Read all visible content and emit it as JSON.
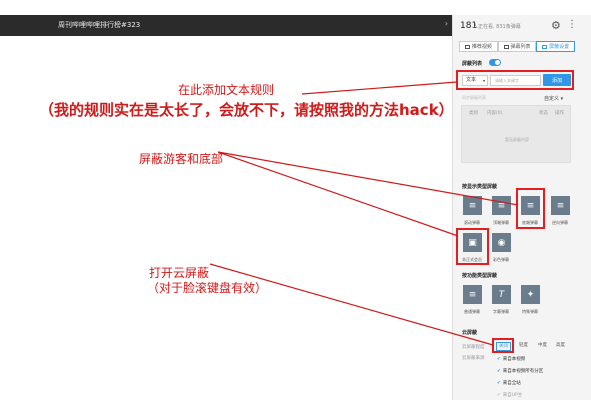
{
  "video": {
    "title": "周刊哔哩哔哩排行榜#323",
    "arrow": "›"
  },
  "annotations": {
    "add_rule": "在此添加文本规则",
    "big_note": "（我的规则实在是太长了，会放不下，请按照我的方法hack）",
    "block_guest": "屏蔽游客和底部",
    "cloud_line1": "打开云屏蔽",
    "cloud_line2": "（对于脸滚键盘有效）",
    "color": "#d01b1b"
  },
  "panel": {
    "online_count": "181",
    "online_text": "人正在看, 831条弹幕",
    "gear_icon": "⚙",
    "more_icon": "⋮",
    "tabs": [
      {
        "label": "推荐视频",
        "active": false
      },
      {
        "label": "弹幕列表",
        "active": false
      },
      {
        "label": "屏蔽设置",
        "active": true
      }
    ],
    "block_list_title": "屏蔽列表",
    "type_select": "文本",
    "type_arrow": "▾",
    "input_placeholder": "请输入关键字",
    "add_button": "添加",
    "sync_text": "同步屏蔽列表",
    "custom_label": "自定义 ▾",
    "table_headers": [
      "类别",
      "内容(0)",
      "状态",
      "操作"
    ],
    "empty_text": "暂无屏蔽内容",
    "by_type_title": "按显示类型屏蔽",
    "type_items": [
      {
        "label": "滚动弹幕",
        "glyph": "≡"
      },
      {
        "label": "顶端弹幕",
        "glyph": "≡"
      },
      {
        "label": "底端弹幕",
        "glyph": "≡"
      },
      {
        "label": "逆向弹幕",
        "glyph": "≡"
      },
      {
        "label": "非正式会员",
        "glyph": "▣"
      },
      {
        "label": "彩色弹幕",
        "glyph": "◉"
      }
    ],
    "by_style_title": "按功能类型屏蔽",
    "style_items": [
      {
        "label": "普通弹幕",
        "glyph": "≡"
      },
      {
        "label": "字幕弹幕",
        "glyph": "T"
      },
      {
        "label": "特殊弹幕",
        "glyph": "✦"
      }
    ],
    "cloud_title": "云屏蔽",
    "cloud_level_label": "云屏蔽程度",
    "levels": [
      {
        "label": "关闭",
        "active": true
      },
      {
        "label": "轻度",
        "active": false
      },
      {
        "label": "中度",
        "active": false
      },
      {
        "label": "高度",
        "active": false
      }
    ],
    "cloud_source_label": "云屏蔽来源",
    "sources": [
      "来自本视频",
      "来自本视频所有分区",
      "来自全站",
      "来自UP主"
    ],
    "accent": "#2f97e6"
  }
}
